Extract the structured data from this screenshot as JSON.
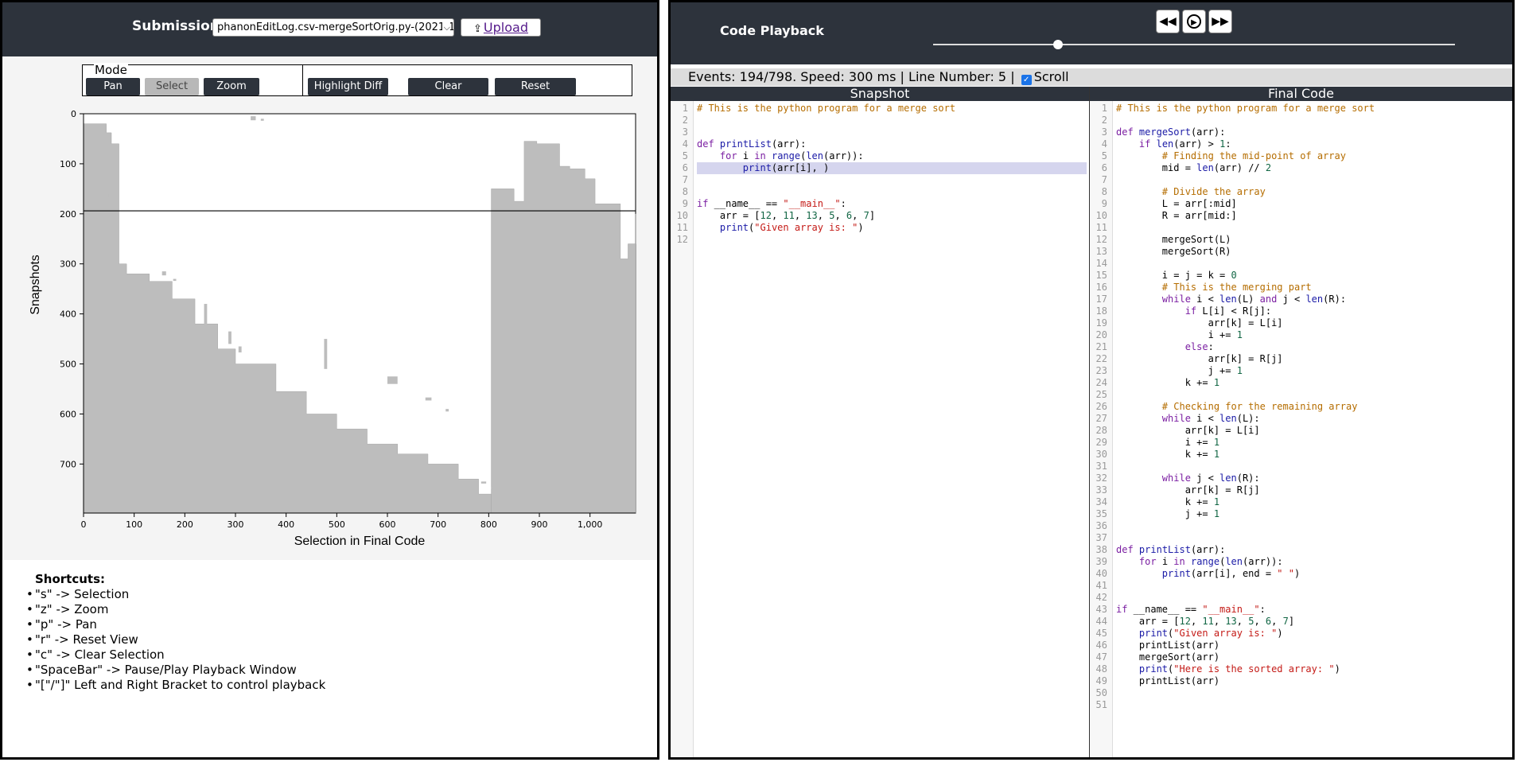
{
  "left": {
    "submission_label": "Submission:",
    "submission_value": "phanonEditLog.csv-mergeSortOrig.py-(2021-1",
    "upload_label": "Upload",
    "mode_label": "Mode",
    "buttons": {
      "pan": "Pan",
      "select": "Select",
      "zoom": "Zoom",
      "highlight_diff": "Highlight Diff",
      "clear": "Clear",
      "reset": "Reset"
    },
    "selected_mode": "Select",
    "shortcuts_title": "Shortcuts:",
    "shortcuts": [
      "\"s\" -> Selection",
      "\"z\" -> Zoom",
      "\"p\" -> Pan",
      "\"r\" -> Reset View",
      "\"c\" -> Clear Selection",
      "\"SpaceBar\" -> Pause/Play Playback Window",
      "\"[\"/\"]\" Left and Right Bracket to control playback"
    ]
  },
  "chart_data": {
    "type": "area",
    "xlabel": "Selection in Final Code",
    "ylabel": "Snapshots",
    "xlim": [
      0,
      1090
    ],
    "ylim": [
      0,
      798
    ],
    "y_inverted": true,
    "x_ticks": [
      "0",
      "100",
      "200",
      "300",
      "400",
      "500",
      "600",
      "700",
      "800",
      "900",
      "1,000"
    ],
    "y_ticks": [
      "0",
      "100",
      "200",
      "300",
      "400",
      "500",
      "600",
      "700"
    ],
    "current_snapshot_line": 194,
    "color": "#bdbdbd",
    "regions": [
      {
        "x": [
          0,
          5,
          25,
          45,
          55,
          70,
          85,
          130,
          175,
          220,
          265,
          300,
          380,
          440,
          500,
          560,
          620,
          680,
          740,
          780,
          805
        ],
        "y_top": [
          20,
          20,
          20,
          38,
          60,
          300,
          320,
          335,
          370,
          420,
          470,
          500,
          555,
          600,
          630,
          660,
          680,
          700,
          730,
          760,
          790
        ],
        "y_bottom": 798
      },
      {
        "x": [
          805,
          808,
          850,
          870,
          895,
          940,
          960,
          990,
          1010,
          1060,
          1075,
          1090
        ],
        "y_top": [
          150,
          150,
          175,
          55,
          60,
          105,
          110,
          130,
          180,
          290,
          260,
          200
        ],
        "y_bottom": 798
      }
    ],
    "blips": [
      [
        330,
        5,
        10,
        8
      ],
      [
        350,
        10,
        6,
        4
      ],
      [
        45,
        160,
        5,
        8
      ],
      [
        155,
        315,
        8,
        8
      ],
      [
        177,
        330,
        6,
        4
      ],
      [
        238,
        380,
        6,
        50
      ],
      [
        286,
        435,
        6,
        25
      ],
      [
        306,
        465,
        6,
        12
      ],
      [
        475,
        450,
        6,
        60
      ],
      [
        600,
        525,
        20,
        15
      ],
      [
        675,
        567,
        12,
        6
      ],
      [
        715,
        590,
        6,
        5
      ],
      [
        785,
        735,
        10,
        4
      ],
      [
        805,
        745,
        5,
        5
      ]
    ]
  },
  "right": {
    "title": "Code Playback",
    "status": "Events: 194/798. Speed: 300 ms | Line Number: 5 |",
    "scroll_label": "Scroll",
    "playback_progress": 0.24,
    "snapshot_header": "Snapshot",
    "final_header": "Final Code",
    "snapshot_highlight_line": 6,
    "snapshot_lines": [
      "# This is the python program for a merge sort",
      "",
      "",
      "def printList(arr):",
      "    for i in range(len(arr)):",
      "        print(arr[i], )",
      "",
      "",
      "if __name__ == \"__main__\":",
      "    arr = [12, 11, 13, 5, 6, 7]",
      "    print(\"Given array is: \")",
      ""
    ],
    "final_lines": [
      "# This is the python program for a merge sort",
      "",
      "def mergeSort(arr):",
      "    if len(arr) > 1:",
      "        # Finding the mid-point of array",
      "        mid = len(arr) // 2",
      "",
      "        # Divide the array",
      "        L = arr[:mid]",
      "        R = arr[mid:]",
      "",
      "        mergeSort(L)",
      "        mergeSort(R)",
      "",
      "        i = j = k = 0",
      "        # This is the merging part",
      "        while i < len(L) and j < len(R):",
      "            if L[i] < R[j]:",
      "                arr[k] = L[i]",
      "                i += 1",
      "            else:",
      "                arr[k] = R[j]",
      "                j += 1",
      "            k += 1",
      "",
      "        # Checking for the remaining array",
      "        while i < len(L):",
      "            arr[k] = L[i]",
      "            i += 1",
      "            k += 1",
      "",
      "        while j < len(R):",
      "            arr[k] = R[j]",
      "            k += 1",
      "            j += 1",
      "",
      "",
      "def printList(arr):",
      "    for i in range(len(arr)):",
      "        print(arr[i], end = \" \")",
      "",
      "",
      "if __name__ == \"__main__\":",
      "    arr = [12, 11, 13, 5, 6, 7]",
      "    print(\"Given array is: \")",
      "    printList(arr)",
      "    mergeSort(arr)",
      "    print(\"Here is the sorted array: \")",
      "    printList(arr)",
      "",
      ""
    ]
  }
}
